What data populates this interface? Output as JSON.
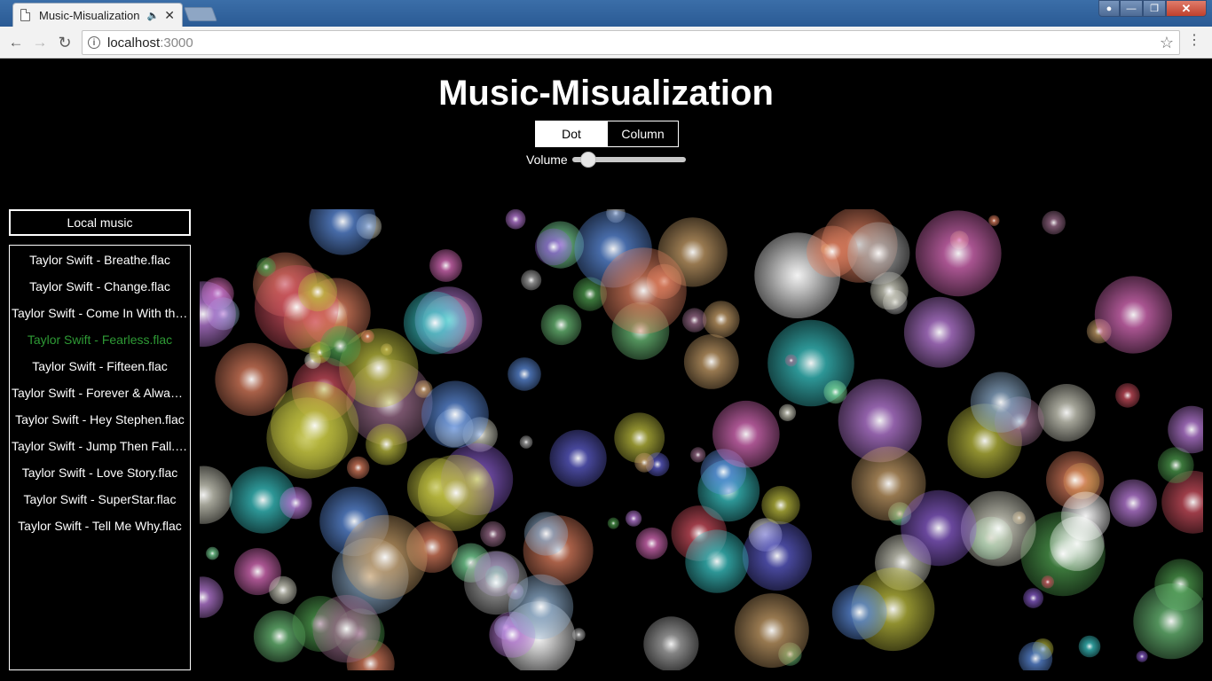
{
  "browser": {
    "tab_title": "Music-Misualization",
    "url_host": "localhost",
    "url_port": ":3000"
  },
  "page": {
    "title": "Music-Misualization",
    "modes": [
      {
        "label": "Dot",
        "active": true
      },
      {
        "label": "Column",
        "active": false
      }
    ],
    "volume_label": "Volume",
    "volume_value": 0.13
  },
  "sidebar": {
    "local_music_label": "Local music",
    "tracks": [
      {
        "label": "Taylor Swift - Breathe.flac",
        "playing": false
      },
      {
        "label": "Taylor Swift - Change.flac",
        "playing": false
      },
      {
        "label": "Taylor Swift - Come In With the Rain.flac",
        "playing": false
      },
      {
        "label": "Taylor Swift - Fearless.flac",
        "playing": true
      },
      {
        "label": "Taylor Swift - Fifteen.flac",
        "playing": false
      },
      {
        "label": "Taylor Swift - Forever & Always.flac",
        "playing": false
      },
      {
        "label": "Taylor Swift - Hey Stephen.flac",
        "playing": false
      },
      {
        "label": "Taylor Swift - Jump Then Fall.flac",
        "playing": false
      },
      {
        "label": "Taylor Swift - Love Story.flac",
        "playing": false
      },
      {
        "label": "Taylor Swift - SuperStar.flac",
        "playing": false
      },
      {
        "label": "Taylor Swift - Tell Me Why.flac",
        "playing": false
      }
    ]
  },
  "colors": {
    "playing_track": "#2e9a35",
    "background": "#000000"
  }
}
